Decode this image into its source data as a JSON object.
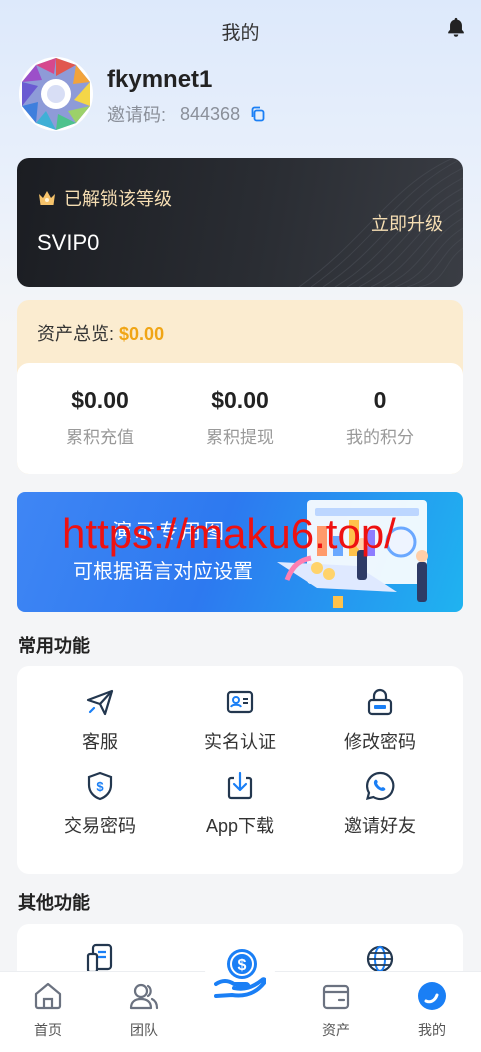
{
  "header": {
    "title": "我的",
    "icon": "bell-icon"
  },
  "profile": {
    "username": "fkymnet1",
    "invite_label": "邀请码:",
    "invite_code": "844368"
  },
  "vip": {
    "unlock_text": "已解锁该等级",
    "level": "SVIP0",
    "upgrade": "立即升级"
  },
  "assets": {
    "title": "资产总览:",
    "total": "$0.00",
    "stats": [
      {
        "value": "$0.00",
        "label": "累积充值"
      },
      {
        "value": "$0.00",
        "label": "累积提现"
      },
      {
        "value": "0",
        "label": "我的积分"
      }
    ]
  },
  "banner": {
    "line1": "演示专用图",
    "line2": "可根据语言对应设置"
  },
  "watermark": "https://maku6.top/",
  "common": {
    "title": "常用功能",
    "items": [
      {
        "label": "客服",
        "icon": "send-icon"
      },
      {
        "label": "实名认证",
        "icon": "id-card-icon"
      },
      {
        "label": "修改密码",
        "icon": "lock-icon"
      },
      {
        "label": "交易密码",
        "icon": "shield-dollar-icon"
      },
      {
        "label": "App下载",
        "icon": "download-icon"
      },
      {
        "label": "邀请好友",
        "icon": "whatsapp-icon"
      }
    ]
  },
  "other": {
    "title": "其他功能",
    "items": [
      {
        "icon": "document-icon"
      },
      {
        "icon": "globe-icon"
      }
    ]
  },
  "tabbar": {
    "items": [
      {
        "label": "首页",
        "icon": "home-icon"
      },
      {
        "label": "团队",
        "icon": "team-icon"
      },
      {
        "label": "",
        "icon": "money-hand-icon"
      },
      {
        "label": "资产",
        "icon": "wallet-icon"
      },
      {
        "label": "我的",
        "icon": "profile-icon"
      }
    ],
    "active_color": "#1a7ff5"
  },
  "colors": {
    "gold": "#f0a515",
    "vip_gold": "#f6deb3",
    "accent": "#1a7ff5"
  }
}
